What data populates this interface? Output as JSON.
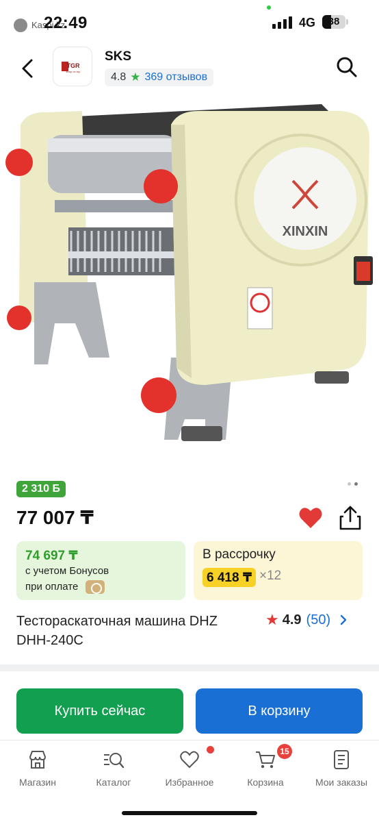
{
  "status_bar": {
    "back_app": "Kaspi.kz",
    "time": "22:49",
    "network": "4G",
    "battery": "38"
  },
  "header": {
    "shop_logo_text": "TGR",
    "shop_logo_subtext": "shop on top",
    "shop_name": "SKS",
    "shop_rating": "4.8",
    "shop_reviews": "369 отзывов"
  },
  "product": {
    "image_brand": "XINXIN",
    "bonus_badge": "2 310 Б",
    "price": "77 007 ₸",
    "bonus_price": "74 697 ₸",
    "bonus_line1": "с учетом Бонусов",
    "bonus_line2": "при оплате",
    "installment_title": "В рассрочку",
    "installment_price": "6 418 ₸",
    "installment_times": "×12",
    "title": "Тестораскаточная машина DHZ DHH-240C",
    "rating": "4.9",
    "rating_count": "(50)",
    "gallery_pages": 2,
    "gallery_active": 1
  },
  "actions": {
    "buy_now": "Купить сейчас",
    "add_to_cart": "В корзину"
  },
  "bottom_nav": {
    "items": [
      {
        "label": "Магазин",
        "icon": "store-icon"
      },
      {
        "label": "Каталог",
        "icon": "catalog-search-icon"
      },
      {
        "label": "Избранное",
        "icon": "heart-outline-icon"
      },
      {
        "label": "Корзина",
        "icon": "cart-icon"
      },
      {
        "label": "Мои заказы",
        "icon": "orders-icon"
      }
    ],
    "cart_badge": "15"
  },
  "colors": {
    "green_bonus": "#3fa53a",
    "blue_link": "#1a6fd4",
    "buy_green": "#12a050",
    "cart_blue": "#1a6fd4",
    "heart_red": "#e23a36",
    "installment_yellow": "#f8d126"
  }
}
